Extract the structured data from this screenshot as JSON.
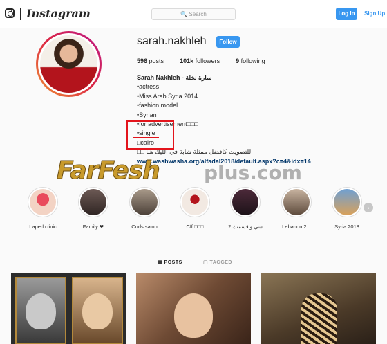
{
  "topbar": {
    "logo_icon": "instagram-camera-icon",
    "wordmark": "Instagram",
    "search_placeholder": "🔍 Search",
    "login_label": "Log In",
    "signup_label": "Sign Up"
  },
  "profile": {
    "username": "sarah.nakhleh",
    "follow_label": "Follow",
    "posts_count": "596",
    "posts_label": "posts",
    "followers_count": "101k",
    "followers_label": "followers",
    "following_count": "9",
    "following_label": "following",
    "bio": {
      "name": "Sarah Nakhleh - سارة نخلة",
      "lines": [
        "•actress",
        "•Miss Arab Syria 2014",
        "•fashion model",
        "•Syrian",
        "•for advertisement□□□",
        "•single",
        "□cairo",
        "□□ للتصويت كافضل ممثلة شابة في الليك هنا"
      ],
      "link": "www.washwasha.org/alfadal2018/default.aspx?c=4&idx=14"
    }
  },
  "watermark": {
    "brand": "FarFesh",
    "suffix": "plus.com"
  },
  "highlights": [
    {
      "label": "Laperl clinic"
    },
    {
      "label": "Family ❤"
    },
    {
      "label": "Curls salon"
    },
    {
      "label": "Cff □□□"
    },
    {
      "label": "2 سي و قسمتك"
    },
    {
      "label": "Lebanon 2..."
    },
    {
      "label": "Syria 2018"
    }
  ],
  "highlights_next_icon": "chevron-right-icon",
  "tabs": {
    "posts": "▦ POSTS",
    "tagged": "▢ TAGGED"
  },
  "colors": {
    "accent": "#3897f0",
    "annotation_red": "#e3141c",
    "avatar_gradient": [
      "#f09433",
      "#dc2743",
      "#bc1888"
    ]
  }
}
